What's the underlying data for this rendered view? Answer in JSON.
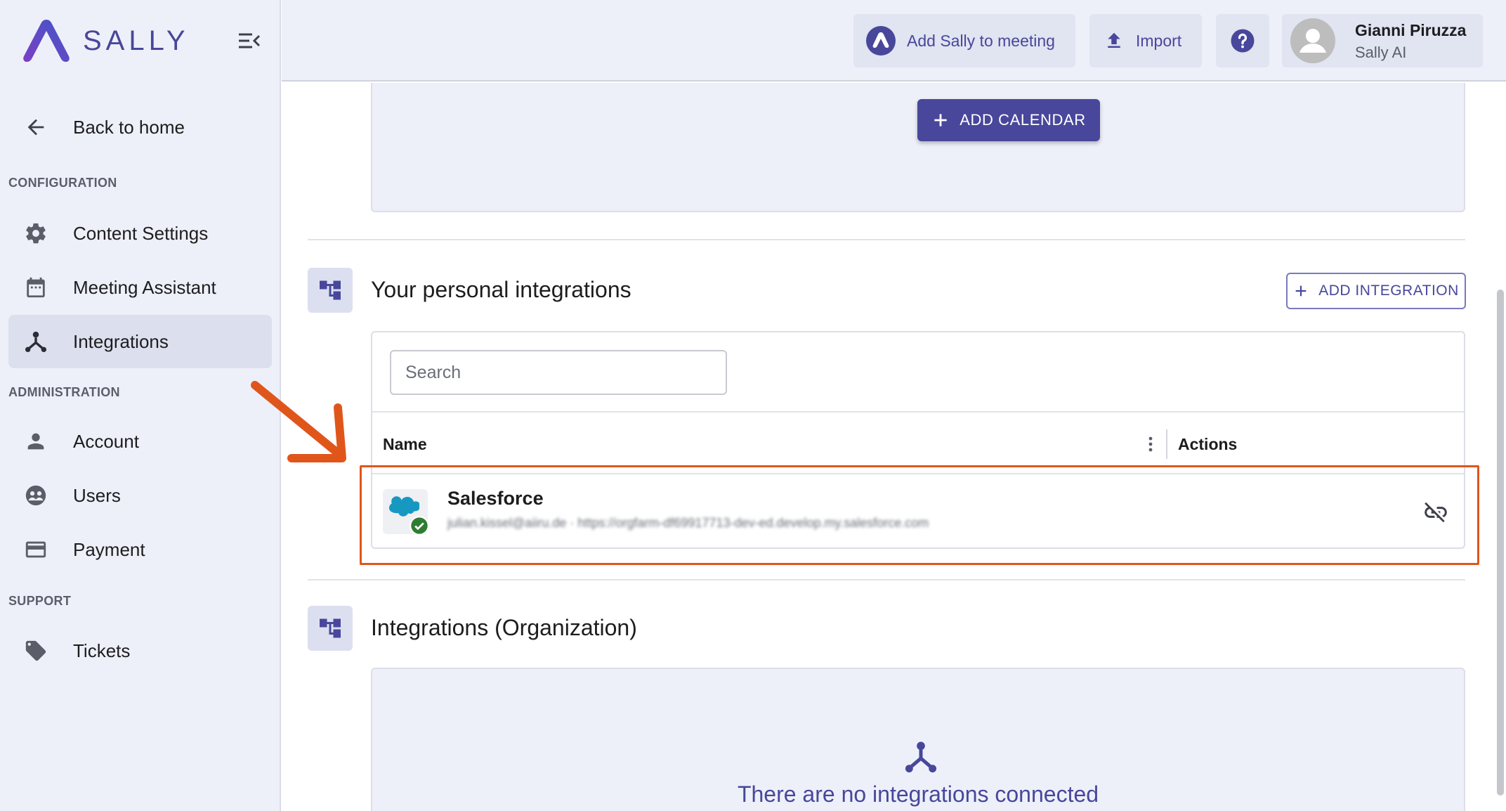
{
  "brand": {
    "name": "SALLY"
  },
  "sidebar": {
    "back_label": "Back to home",
    "sections": [
      {
        "label": "CONFIGURATION",
        "items": [
          {
            "label": "Content Settings",
            "icon": "gear-icon"
          },
          {
            "label": "Meeting Assistant",
            "icon": "calendar-icon"
          },
          {
            "label": "Integrations",
            "icon": "integrations-icon",
            "active": true
          }
        ]
      },
      {
        "label": "ADMINISTRATION",
        "items": [
          {
            "label": "Account",
            "icon": "person-icon"
          },
          {
            "label": "Users",
            "icon": "users-icon"
          },
          {
            "label": "Payment",
            "icon": "credit-card-icon"
          }
        ]
      },
      {
        "label": "SUPPORT",
        "items": [
          {
            "label": "Tickets",
            "icon": "tag-icon"
          }
        ]
      }
    ]
  },
  "topbar": {
    "add_sally_label": "Add Sally to meeting",
    "import_label": "Import",
    "user": {
      "name": "Gianni Piruzza",
      "org": "Sally AI"
    }
  },
  "calendar": {
    "add_label": "ADD CALENDAR"
  },
  "personal": {
    "title": "Your personal integrations",
    "add_label": "ADD INTEGRATION",
    "search_placeholder": "Search",
    "columns": {
      "name": "Name",
      "actions": "Actions"
    },
    "rows": [
      {
        "name": "Salesforce",
        "detail": "julian.kissel@aiiru.de · https://orgfarm-df69917713-dev-ed.develop.my.salesforce.com",
        "status": "connected"
      }
    ]
  },
  "organization": {
    "title": "Integrations (Organization)",
    "empty_text": "There are no integrations connected"
  },
  "colors": {
    "accent": "#48479b",
    "highlight": "#e0561a",
    "sidebar_bg": "#eef0f9",
    "salesforce": "#1798c1",
    "success": "#2e7d32"
  }
}
